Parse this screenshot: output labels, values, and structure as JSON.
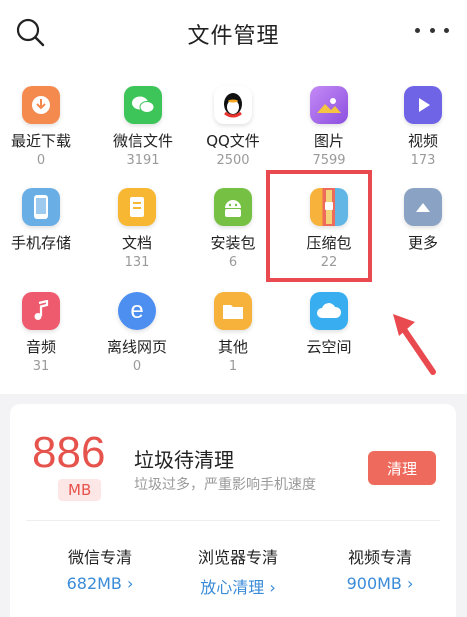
{
  "header": {
    "title": "文件管理"
  },
  "categories": [
    {
      "label": "最近下载",
      "count": "0",
      "icon": "download-icon",
      "color": "#f58a4f"
    },
    {
      "label": "微信文件",
      "count": "3191",
      "icon": "wechat-icon",
      "color": "#3ec55a"
    },
    {
      "label": "QQ文件",
      "count": "2500",
      "icon": "qq-penguin-icon",
      "color": "#ffffff"
    },
    {
      "label": "图片",
      "count": "7599",
      "icon": "picture-icon",
      "color": "#b06bea"
    },
    {
      "label": "视频",
      "count": "173",
      "icon": "play-icon",
      "color": "#6f64e6"
    },
    {
      "label": "手机存储",
      "count": "",
      "icon": "phone-storage-icon",
      "color": "#6aaee6"
    },
    {
      "label": "文档",
      "count": "131",
      "icon": "document-icon",
      "color": "#f7b733"
    },
    {
      "label": "安装包",
      "count": "6",
      "icon": "android-icon",
      "color": "#76c043"
    },
    {
      "label": "压缩包",
      "count": "22",
      "icon": "archive-icon",
      "color": "#f0a13a"
    },
    {
      "label": "更多",
      "count": "",
      "icon": "chevron-up-icon",
      "color": "#8aa3c4"
    },
    {
      "label": "音频",
      "count": "31",
      "icon": "music-note-icon",
      "color": "#ee5b6e"
    },
    {
      "label": "离线网页",
      "count": "0",
      "icon": "browser-e-icon",
      "color": "#4d8ff0"
    },
    {
      "label": "其他",
      "count": "1",
      "icon": "folder-icon",
      "color": "#f6b23a"
    },
    {
      "label": "云空间",
      "count": "",
      "icon": "cloud-icon",
      "color": "#38aef0"
    }
  ],
  "cleaner": {
    "size_value": "886",
    "size_unit": "MB",
    "title": "垃圾待清理",
    "subtitle": "垃圾过多，严重影响手机速度",
    "button_label": "清理",
    "accent_color": "#e6534c"
  },
  "stats": [
    {
      "name": "微信专清",
      "value": "682MB",
      "chevron": "›"
    },
    {
      "name": "浏览器专清",
      "value": "放心清理",
      "chevron": "›"
    },
    {
      "name": "视频专清",
      "value": "900MB",
      "chevron": "›"
    }
  ],
  "annotation": {
    "highlight_color": "#e94a4f"
  }
}
